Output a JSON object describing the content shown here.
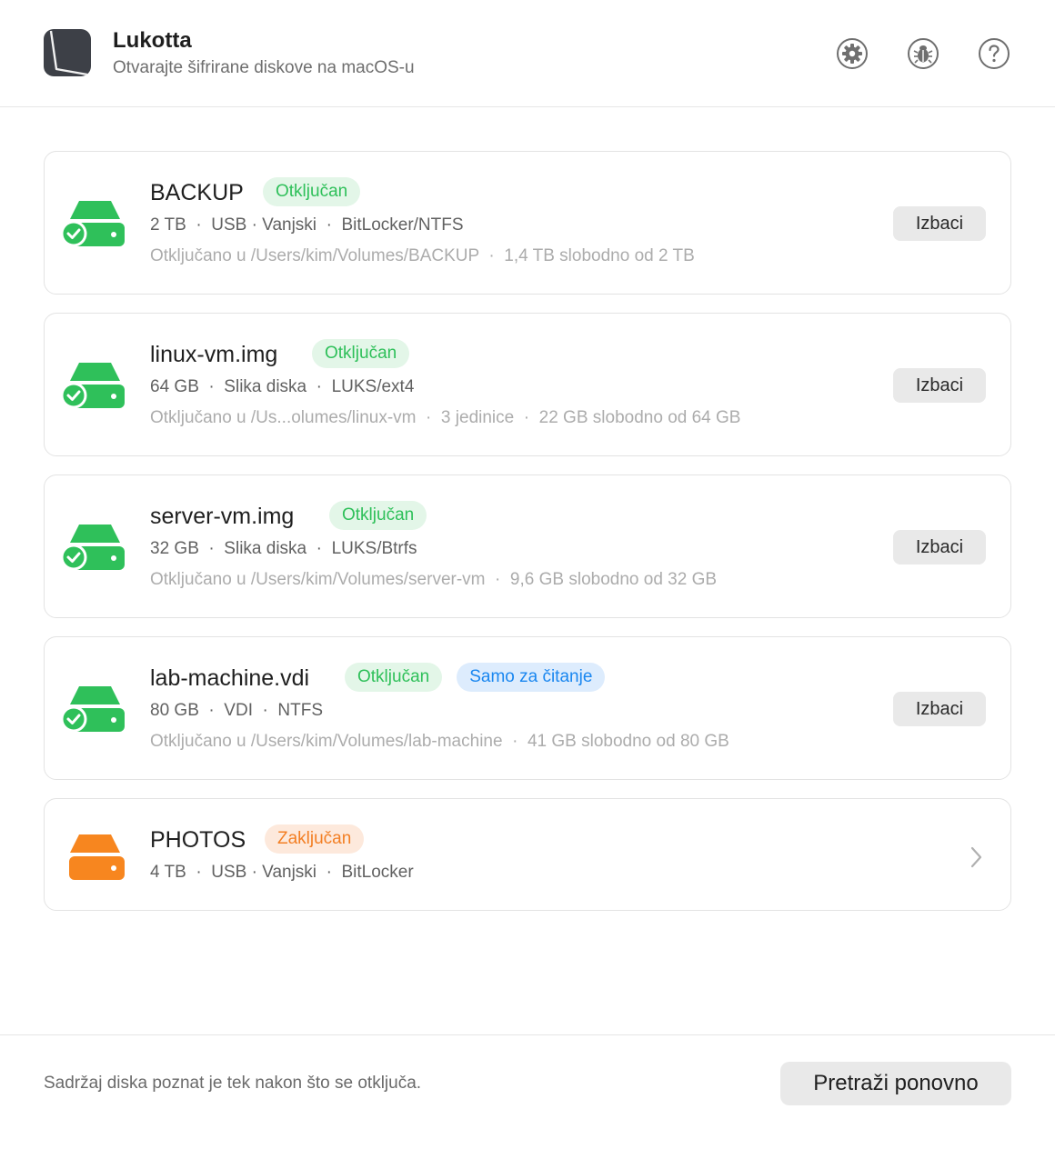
{
  "app": {
    "title": "Lukotta",
    "subtitle": "Otvarajte šifrirane diskove na macOS-u"
  },
  "header_buttons": [
    {
      "name": "settings",
      "icon": "gear-icon"
    },
    {
      "name": "debug",
      "icon": "bug-icon"
    },
    {
      "name": "help",
      "icon": "question-icon"
    }
  ],
  "colors": {
    "unlocked_green": "#2fc05a",
    "readonly_blue": "#1a87f0",
    "locked_orange": "#f37f24"
  },
  "drives": [
    {
      "name": "BACKUP",
      "state": "unlocked",
      "badges": [
        "Otključan"
      ],
      "meta": "2 TB  ·  USB · Vanjski  ·  BitLocker/NTFS",
      "detail": "Otključano u /Users/kim/Volumes/BACKUP  ·  1,4 TB slobodno od 2 TB",
      "action": "Izbaci"
    },
    {
      "name": "linux-vm.img",
      "state": "unlocked",
      "badges": [
        "Otključan"
      ],
      "meta": "64 GB  ·  Slika diska  ·  LUKS/ext4",
      "detail": "Otključano u /Us...olumes/linux-vm  ·  3 jedinice  ·  22 GB slobodno od 64 GB",
      "action": "Izbaci"
    },
    {
      "name": "server-vm.img",
      "state": "unlocked",
      "badges": [
        "Otključan"
      ],
      "meta": "32 GB  ·  Slika diska  ·  LUKS/Btrfs",
      "detail": "Otključano u /Users/kim/Volumes/server-vm  ·  9,6 GB slobodno od 32 GB",
      "action": "Izbaci"
    },
    {
      "name": "lab-machine.vdi",
      "state": "unlocked",
      "badges": [
        "Otključan",
        "Samo za čitanje"
      ],
      "meta": "80 GB  ·  VDI  ·  NTFS",
      "detail": "Otključano u /Users/kim/Volumes/lab-machine  ·  41 GB slobodno od 80 GB",
      "action": "Izbaci"
    },
    {
      "name": "PHOTOS",
      "state": "locked",
      "badges": [
        "Zaključan"
      ],
      "meta": "4 TB  ·  USB · Vanjski  ·  BitLocker",
      "icon": "chevron-right-icon"
    }
  ],
  "footer": {
    "note": "Sadržaj diska poznat je tek nakon što se otključa.",
    "rescan_label": "Pretraži ponovno"
  }
}
